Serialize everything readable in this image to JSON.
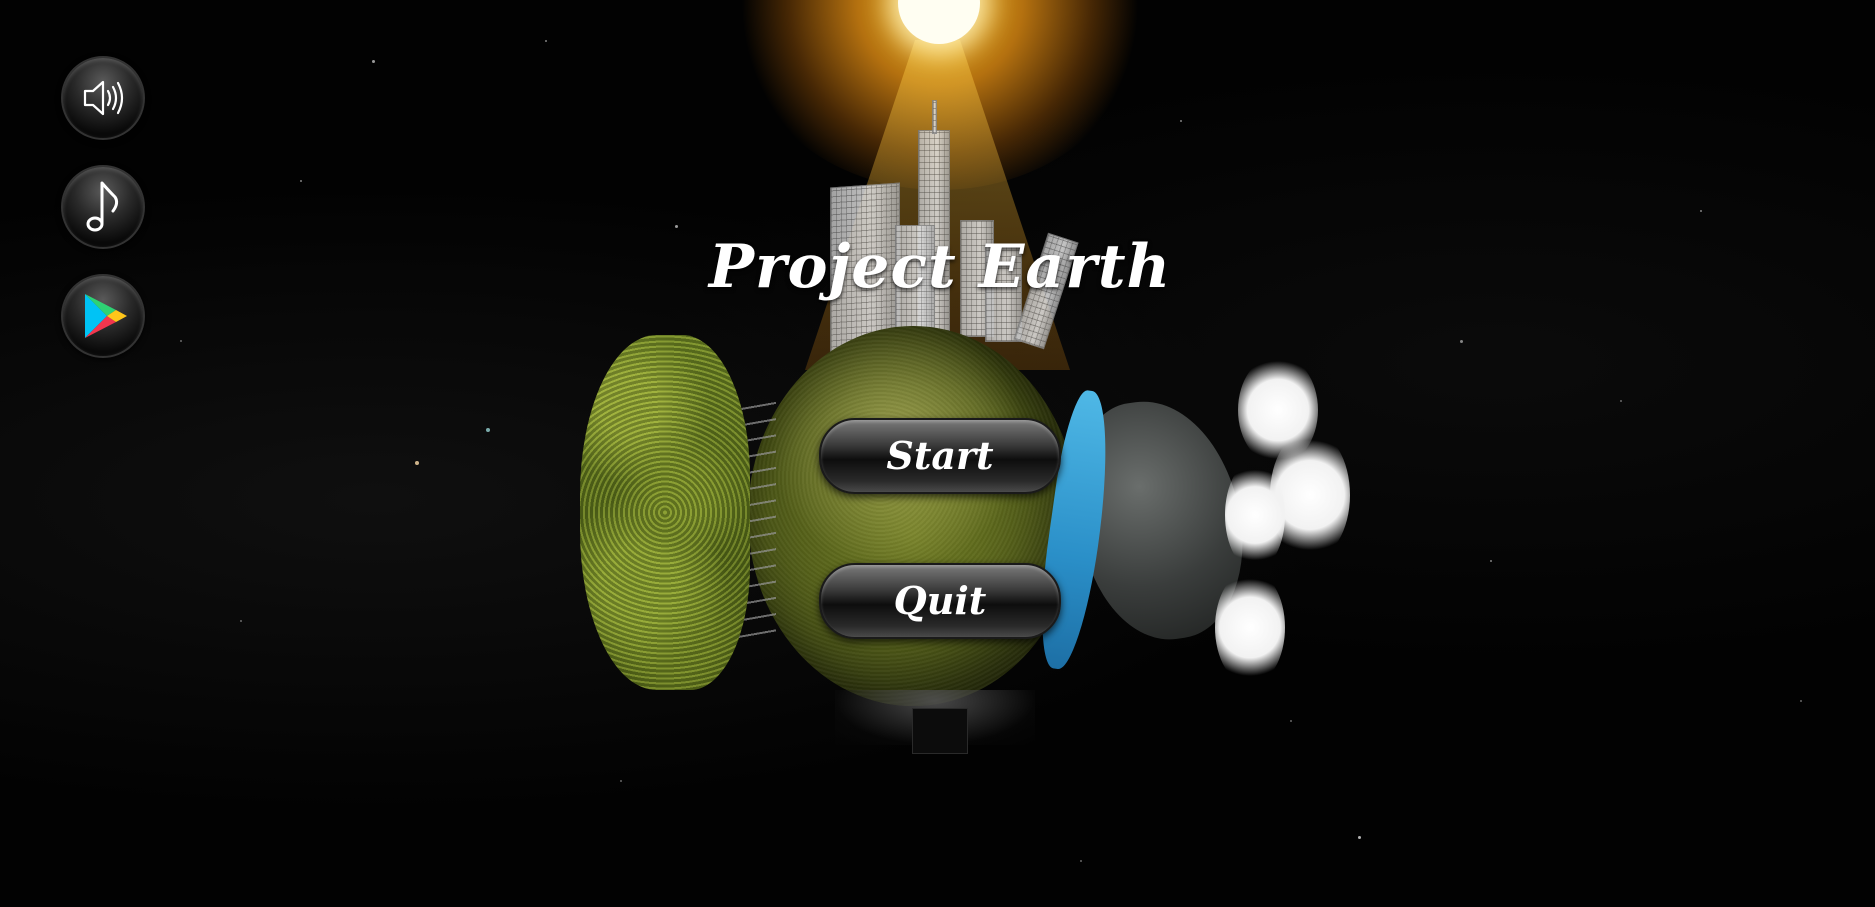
{
  "game": {
    "title": "Project Earth"
  },
  "menu": {
    "start_label": "Start",
    "quit_label": "Quit"
  },
  "side_buttons": [
    {
      "icon": "speaker-icon",
      "action": "sound"
    },
    {
      "icon": "music-note-icon",
      "action": "music"
    },
    {
      "icon": "google-play-icon",
      "action": "play-store"
    }
  ],
  "colors": {
    "background": "#020202",
    "sun": "#ffc828",
    "planet": "#5a6a1c",
    "water": "#2a8fc8",
    "button_text": "#ffffff"
  }
}
